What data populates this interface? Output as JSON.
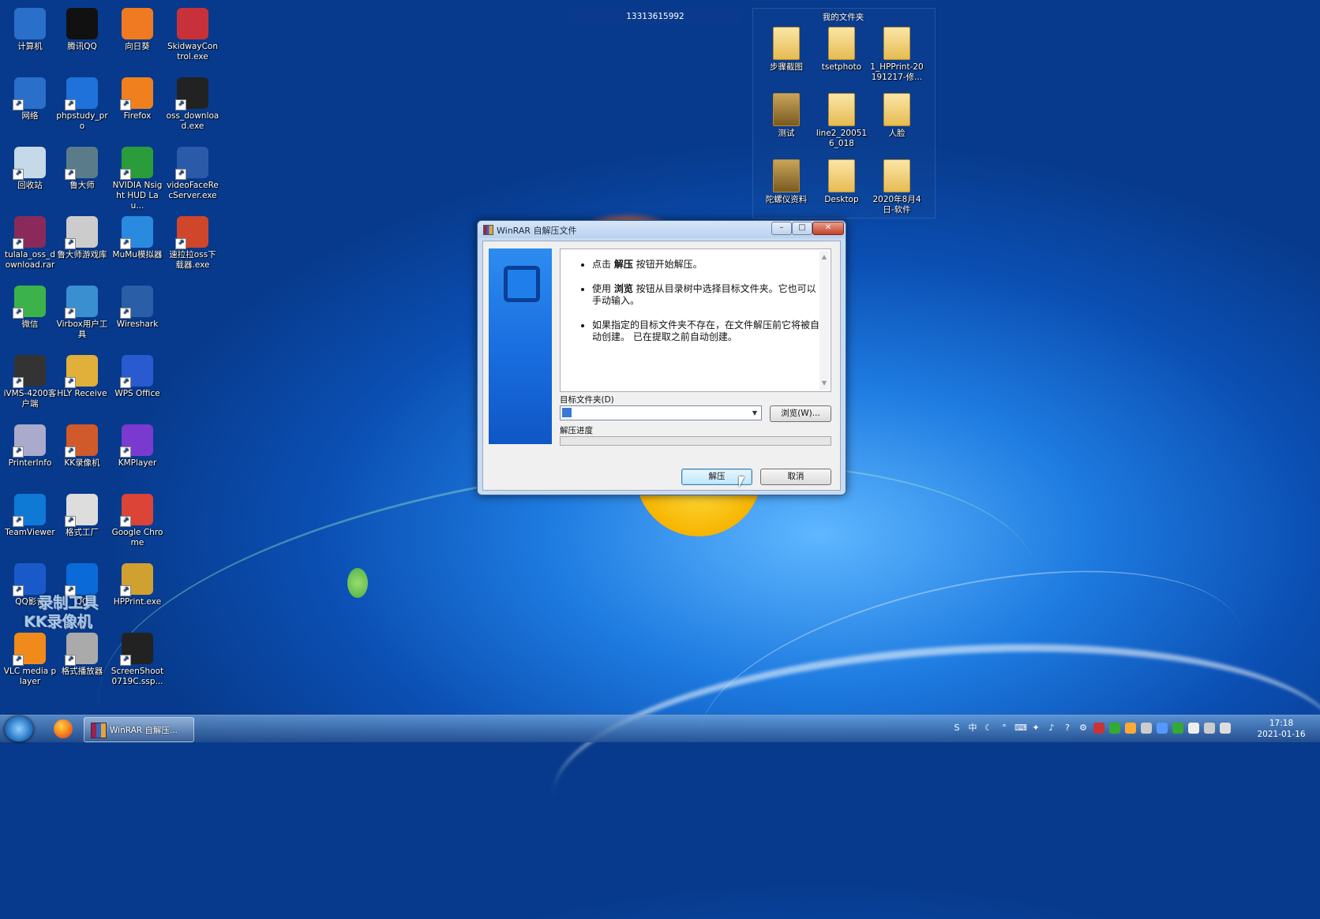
{
  "top_bar": {
    "number": "13313615992"
  },
  "desktop_icons": [
    {
      "label": "计算机"
    },
    {
      "label": "腾讯QQ"
    },
    {
      "label": "向日葵"
    },
    {
      "label": "SkidwayControl.exe"
    },
    {
      "label": "网络"
    },
    {
      "label": "phpstudy_pro"
    },
    {
      "label": "Firefox"
    },
    {
      "label": "oss_download.exe"
    },
    {
      "label": "回收站"
    },
    {
      "label": "鲁大师"
    },
    {
      "label": "NVIDIA Nsight HUD Lau..."
    },
    {
      "label": "videoFaceRecServer.exe"
    },
    {
      "label": "tulala_oss_download.rar"
    },
    {
      "label": "鲁大师游戏库"
    },
    {
      "label": "MuMu模拟器"
    },
    {
      "label": "速拉拉oss下载器.exe"
    },
    {
      "label": "微信"
    },
    {
      "label": "Virbox用户工具"
    },
    {
      "label": "Wireshark"
    },
    {
      "label": "iVMS-4200客户端"
    },
    {
      "label": "HLY Receive"
    },
    {
      "label": "WPS Office"
    },
    {
      "label": "PrinterInfo"
    },
    {
      "label": "KK录像机"
    },
    {
      "label": "KMPlayer"
    },
    {
      "label": "TeamViewer"
    },
    {
      "label": "格式工厂"
    },
    {
      "label": "Google Chrome"
    },
    {
      "label": "QQ影音"
    },
    {
      "label": "QQ"
    },
    {
      "label": "HPPrint.exe"
    },
    {
      "label": "VLC media player"
    },
    {
      "label": "格式播放器"
    },
    {
      "label": "ScreenShoot0719C.ssp..."
    }
  ],
  "folder_group": {
    "title": "我的文件夹",
    "folders": [
      {
        "label": "步骤截图"
      },
      {
        "label": "tsetphoto"
      },
      {
        "label": "1_HPPrint-20191217-修..."
      },
      {
        "label": "测试"
      },
      {
        "label": "line2_200516_018"
      },
      {
        "label": "人脸"
      },
      {
        "label": "陀螺仪资料"
      },
      {
        "label": "Desktop"
      },
      {
        "label": "2020年8月4日-软件"
      }
    ]
  },
  "watermark": {
    "line1": "录制工具",
    "line2": "KK录像机"
  },
  "dialog": {
    "title": "WinRAR 自解压文件",
    "minimize": "–",
    "maximize": "□",
    "close": "✕",
    "bullets": [
      {
        "pre": "点击 ",
        "bold": "解压",
        "post": " 按钮开始解压。"
      },
      {
        "pre": "使用 ",
        "bold": "浏览",
        "post": " 按钮从目录树中选择目标文件夹。它也可以手动输入。"
      },
      {
        "pre": "",
        "bold": "",
        "post": "如果指定的目标文件夹不存在，在文件解压前它将被自动创建。 已在提取之前自动创建。"
      }
    ],
    "target_folder_label": "目标文件夹(D)",
    "target_folder_value": "",
    "browse_label": "浏览(W)...",
    "progress_label": "解压进度",
    "progress": 0,
    "extract_label": "解压",
    "cancel_label": "取消"
  },
  "taskbar": {
    "winrar_title": "WinRAR 自解压...",
    "tray": [
      "S",
      "中",
      "☾",
      "°",
      "⌨",
      "✦",
      "♪",
      "?",
      "⚙"
    ],
    "time": "17:18",
    "date": "2021-01-16"
  }
}
